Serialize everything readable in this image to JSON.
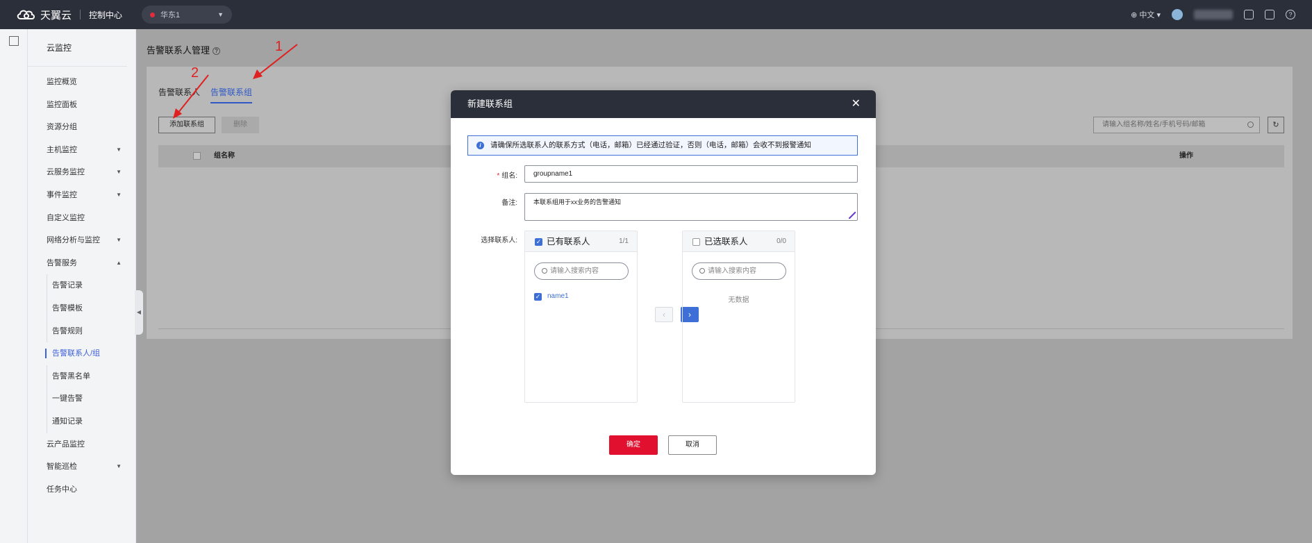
{
  "topbar": {
    "brand": "天翼云",
    "console": "控制中心",
    "region": "华东1",
    "language": "中文"
  },
  "sidebar": {
    "title": "云监控",
    "items": [
      {
        "label": "监控概览"
      },
      {
        "label": "监控面板"
      },
      {
        "label": "资源分组"
      },
      {
        "label": "主机监控",
        "arrow": "▼"
      },
      {
        "label": "云服务监控",
        "arrow": "▼"
      },
      {
        "label": "事件监控",
        "arrow": "▼"
      },
      {
        "label": "自定义监控"
      },
      {
        "label": "网络分析与监控",
        "arrow": "▼"
      },
      {
        "label": "告警服务",
        "arrow": "▲"
      },
      {
        "label": "告警记录",
        "sub": true
      },
      {
        "label": "告警模板",
        "sub": true
      },
      {
        "label": "告警规则",
        "sub": true
      },
      {
        "label": "告警联系人/组",
        "sub": true,
        "active": true
      },
      {
        "label": "告警黑名单",
        "sub": true
      },
      {
        "label": "一键告警",
        "sub": true
      },
      {
        "label": "通知记录",
        "sub": true
      },
      {
        "label": "云产品监控"
      },
      {
        "label": "智能巡检",
        "arrow": "▼"
      },
      {
        "label": "任务中心"
      }
    ]
  },
  "main": {
    "page_title": "告警联系人管理",
    "tabs": [
      "告警联系人",
      "告警联系组"
    ],
    "add_button": "添加联系组",
    "delete_button": "删除",
    "search_placeholder": "请输入组名称/姓名/手机号码/邮箱",
    "columns": [
      "组名称",
      "操作"
    ]
  },
  "annotations": {
    "one": "1",
    "two": "2"
  },
  "modal": {
    "title": "新建联系组",
    "notice": "请确保所选联系人的联系方式（电话，邮箱）已经通过验证，否则（电话，邮箱）会收不到报警通知",
    "group_name_label": "组名:",
    "group_name_value": "groupname1",
    "remark_label": "备注:",
    "remark_value": "本联系组用于xx业务的告警通知",
    "select_label": "选择联系人:",
    "left_panel": {
      "title": "已有联系人",
      "count": "1/1",
      "search_placeholder": "请输入搜索内容",
      "items": [
        "name1"
      ]
    },
    "right_panel": {
      "title": "已选联系人",
      "count": "0/0",
      "search_placeholder": "请输入搜索内容",
      "empty": "无数据"
    },
    "ok_button": "确定",
    "cancel_button": "取消"
  },
  "colors": {
    "topbar_bg": "#2b2f3a",
    "primary": "#3d6fd6",
    "confirm": "#e0102e",
    "annotation": "#e02020"
  }
}
